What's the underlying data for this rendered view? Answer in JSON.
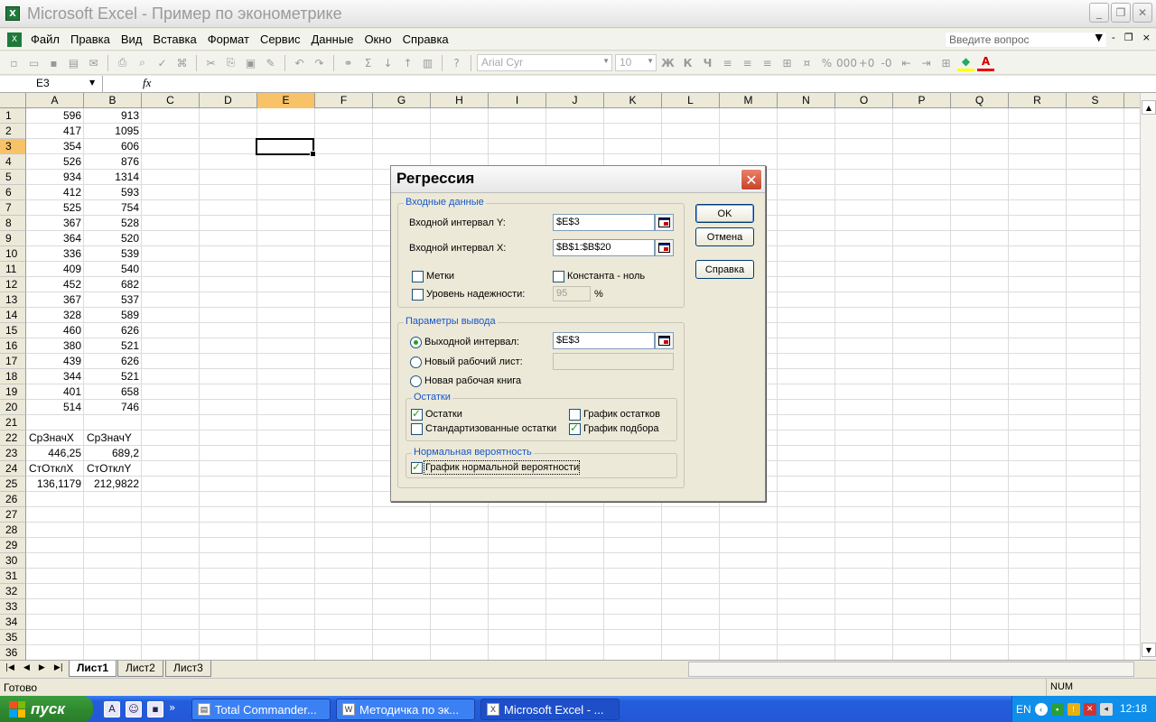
{
  "app": {
    "title": "Microsoft Excel - Пример по эконометрике",
    "icon": "excel-icon"
  },
  "window_controls": {
    "minimize": "_",
    "restore": "❐",
    "close": "✕"
  },
  "menu": {
    "items": [
      "Файл",
      "Правка",
      "Вид",
      "Вставка",
      "Формат",
      "Сервис",
      "Данные",
      "Окно",
      "Справка"
    ],
    "ask_placeholder": "Введите вопрос",
    "doc_controls": [
      "▼",
      "-",
      "❐",
      "×"
    ]
  },
  "toolbar": {
    "font_name": "Arial Cyr",
    "font_size": "10",
    "format_buttons": [
      "Ж",
      "К",
      "Ч"
    ],
    "icons": [
      "new-icon",
      "open-icon",
      "save-icon",
      "permission-icon",
      "email-icon",
      "print-icon",
      "preview-icon",
      "spelling-icon",
      "research-icon",
      "cut-icon",
      "copy-icon",
      "paste-icon",
      "format-painter-icon",
      "undo-icon",
      "redo-icon",
      "hyperlink-icon",
      "autosum-icon",
      "sort-asc-icon",
      "sort-desc-icon",
      "chart-icon",
      "help-icon"
    ]
  },
  "formula_bar": {
    "name_box": "E3",
    "fx": "fx",
    "value": ""
  },
  "sheet": {
    "columns": [
      "A",
      "B",
      "C",
      "D",
      "E",
      "F",
      "G",
      "H",
      "I",
      "J",
      "K",
      "L",
      "M",
      "N",
      "O",
      "P",
      "Q",
      "R",
      "S"
    ],
    "selected_column": "E",
    "selected_row": "3",
    "row_count": 36,
    "data_rows": [
      [
        "596",
        "913"
      ],
      [
        "417",
        "1095"
      ],
      [
        "354",
        "606"
      ],
      [
        "526",
        "876"
      ],
      [
        "934",
        "1314"
      ],
      [
        "412",
        "593"
      ],
      [
        "525",
        "754"
      ],
      [
        "367",
        "528"
      ],
      [
        "364",
        "520"
      ],
      [
        "336",
        "539"
      ],
      [
        "409",
        "540"
      ],
      [
        "452",
        "682"
      ],
      [
        "367",
        "537"
      ],
      [
        "328",
        "589"
      ],
      [
        "460",
        "626"
      ],
      [
        "380",
        "521"
      ],
      [
        "439",
        "626"
      ],
      [
        "344",
        "521"
      ],
      [
        "401",
        "658"
      ],
      [
        "514",
        "746"
      ]
    ],
    "stats": {
      "r22": [
        "СрЗначX",
        "СрЗначY"
      ],
      "r23": [
        "446,25",
        "689,2"
      ],
      "r24": [
        "СтОтклX",
        "СтОтклY"
      ],
      "r25": [
        "136,1179",
        "212,9822"
      ]
    }
  },
  "sheet_tabs": [
    "Лист1",
    "Лист2",
    "Лист3"
  ],
  "active_sheet": "Лист1",
  "status": {
    "text": "Готово",
    "num": "NUM"
  },
  "dialog": {
    "title": "Регрессия",
    "close": "✕",
    "input_group": "Входные данные",
    "input_y_label": "Входной интервал Y:",
    "input_y_value": "$E$3",
    "input_x_label": "Входной интервал X:",
    "input_x_value": "$B$1:$B$20",
    "labels_cb": "Метки",
    "labels_checked": false,
    "constant_zero_cb": "Константа - ноль",
    "constant_zero_checked": false,
    "confidence_cb": "Уровень надежности:",
    "confidence_checked": false,
    "confidence_value": "95",
    "percent": "%",
    "output_group": "Параметры вывода",
    "output_range_label": "Выходной интервал:",
    "output_range_value": "$E$3",
    "output_range_selected": true,
    "new_sheet_label": "Новый рабочий лист:",
    "new_book_label": "Новая рабочая книга",
    "residuals_group": "Остатки",
    "residuals_cb": "Остатки",
    "residuals_checked": true,
    "std_residuals_cb": "Стандартизованные остатки",
    "std_residuals_checked": false,
    "residual_plots_cb": "График остатков",
    "residual_plots_checked": false,
    "line_fit_cb": "График подбора",
    "line_fit_checked": true,
    "normal_group": "Нормальная вероятность",
    "normal_plot_cb": "График нормальной вероятности",
    "normal_plot_checked": true,
    "ok": "OK",
    "cancel": "Отмена",
    "help": "Справка"
  },
  "taskbar": {
    "start": "пуск",
    "quick_launch": [
      "A",
      "☺",
      "▪",
      "»"
    ],
    "tasks": [
      "Total Commander...",
      "Методичка по эк...",
      "Microsoft Excel - ..."
    ],
    "active_task": "Microsoft Excel - ...",
    "lang": "EN",
    "clock": "12:18"
  }
}
